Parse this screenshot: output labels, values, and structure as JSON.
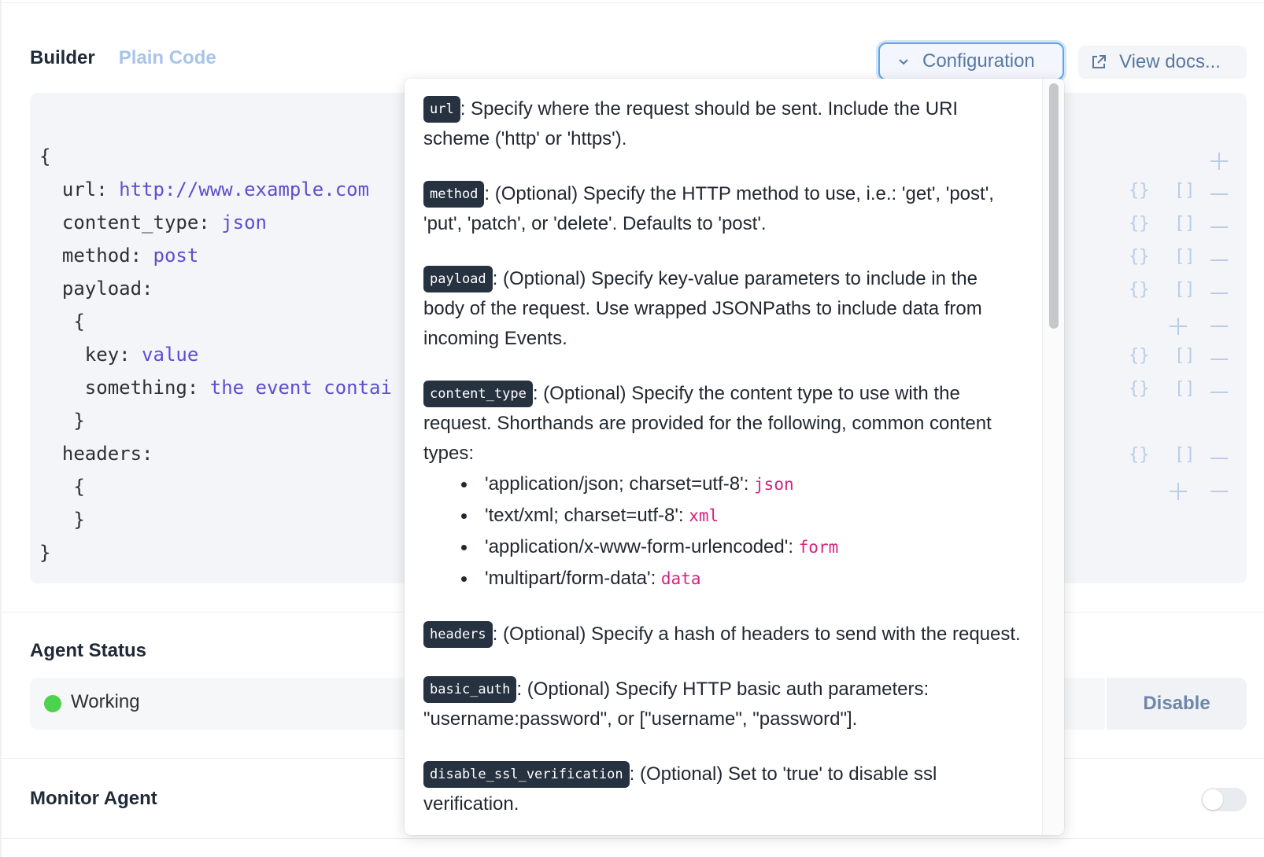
{
  "tabs": {
    "builder": "Builder",
    "plain_code": "Plain Code"
  },
  "toolbar": {
    "configuration": "Configuration",
    "view_docs": "View docs..."
  },
  "code": {
    "open": "{",
    "url_key": "url: ",
    "url_value": "http://www.example.com",
    "content_type_key": "content_type: ",
    "content_type_value": "json",
    "method_key": "method: ",
    "method_value": "post",
    "payload_key": "payload:",
    "payload_open": "{",
    "key_key": "key: ",
    "key_value": "value",
    "something_key": "something: ",
    "something_value": "the event contai",
    "payload_close": "}",
    "headers_key": "headers:",
    "headers_open": "{",
    "headers_close": "}",
    "close": "}"
  },
  "controls": {
    "obj": "{}",
    "arr": "[]"
  },
  "agent_status": {
    "title": "Agent Status",
    "status": "Working",
    "disable": "Disable",
    "status_color": "#4cd24c"
  },
  "monitor": {
    "title": "Monitor Agent",
    "enabled": false
  },
  "popover": {
    "url": {
      "tag": "url",
      "text": ": Specify where the request should be sent. Include the URI scheme ('http' or 'https')."
    },
    "method": {
      "tag": "method",
      "text": ": (Optional) Specify the HTTP method to use, i.e.: 'get', 'post', 'put', 'patch', or 'delete'. Defaults to 'post'."
    },
    "payload": {
      "tag": "payload",
      "text": ": (Optional) Specify key-value parameters to include in the body of the request. Use wrapped JSONPaths to include data from incoming Events."
    },
    "content_type": {
      "tag": "content_type",
      "text": ": (Optional) Specify the content type to use with the request. Shorthands are provided for the following, common content types:"
    },
    "shorthands": [
      {
        "label": "'application/json; charset=utf-8': ",
        "code": "json"
      },
      {
        "label": "'text/xml; charset=utf-8': ",
        "code": "xml"
      },
      {
        "label": "'application/x-www-form-urlencoded': ",
        "code": "form"
      },
      {
        "label": "'multipart/form-data': ",
        "code": "data"
      }
    ],
    "headers": {
      "tag": "headers",
      "text": ": (Optional) Specify a hash of headers to send with the request."
    },
    "basic_auth": {
      "tag": "basic_auth",
      "text": ": (Optional) Specify HTTP basic auth parameters: \"username:password\", or [\"username\", \"password\"]."
    },
    "disable_ssl": {
      "tag": "disable_ssl_verification",
      "text": ": (Optional) Set to 'true' to disable ssl verification."
    }
  },
  "colors": {
    "accent": "#5aa6f0",
    "value_purple": "#5b4fd0",
    "code_pink": "#d6227f",
    "tag_bg": "#263240"
  }
}
